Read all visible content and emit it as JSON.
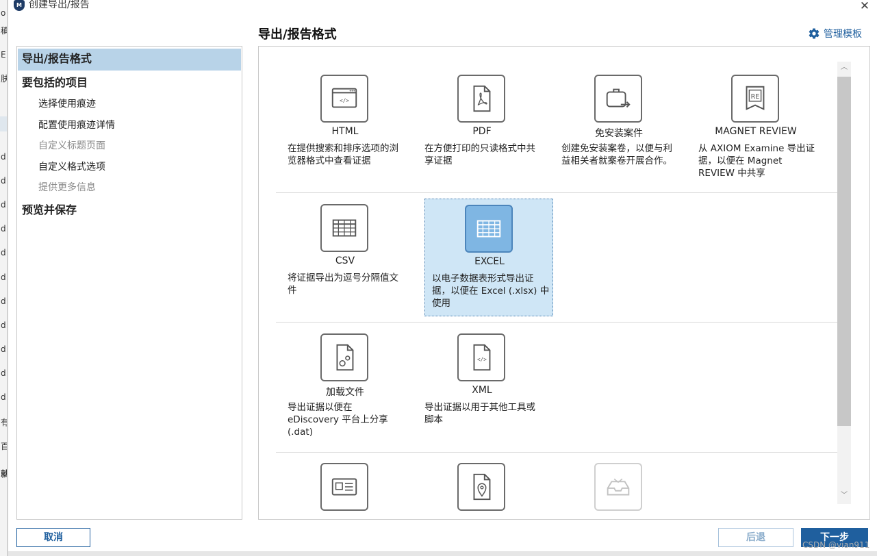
{
  "window": {
    "title": "创建导出/报告",
    "close_glyph": "✕"
  },
  "header": {
    "title": "导出/报告格式",
    "manage_templates": "管理模板"
  },
  "nav": {
    "items": [
      {
        "label": "导出/报告格式",
        "kind": "section",
        "active": true
      },
      {
        "label": "要包括的项目",
        "kind": "section"
      },
      {
        "label": "选择使用痕迹",
        "kind": "sub"
      },
      {
        "label": "配置使用痕迹详情",
        "kind": "sub"
      },
      {
        "label": "自定义标题页面",
        "kind": "sub",
        "disabled": true
      },
      {
        "label": "自定义格式选项",
        "kind": "sub"
      },
      {
        "label": "提供更多信息",
        "kind": "sub",
        "disabled": true
      },
      {
        "label": "预览并保存",
        "kind": "section"
      }
    ]
  },
  "formats": [
    {
      "name": "HTML",
      "desc": "在提供搜索和排序选项的浏览器格式中查看证据",
      "icon": "html-browser-icon"
    },
    {
      "name": "PDF",
      "desc": "在方便打印的只读格式中共享证据",
      "icon": "pdf-file-icon"
    },
    {
      "name": "免安装案件",
      "desc": "创建免安装案卷，以便与利益相关者就案卷开展合作。",
      "icon": "portable-case-icon"
    },
    {
      "name": "MAGNET REVIEW",
      "desc": "从 AXIOM Examine 导出证据，以便在 Magnet REVIEW 中共享",
      "icon": "magnet-review-icon"
    },
    {
      "name": "CSV",
      "desc": "将证据导出为逗号分隔值文件",
      "icon": "csv-table-icon"
    },
    {
      "name": "EXCEL",
      "desc": "以电子数据表形式导出证据，以便在 Excel (.xlsx) 中使用",
      "icon": "excel-table-icon",
      "selected": true
    },
    {
      "name": "加载文件",
      "desc": "导出证据以便在 eDiscovery 平台上分享 (.dat)",
      "icon": "load-file-icon"
    },
    {
      "name": "XML",
      "desc": "导出证据以用于其他工具或脚本",
      "icon": "xml-file-icon"
    },
    {
      "name": "",
      "desc": "",
      "icon": "id-card-icon"
    },
    {
      "name": "",
      "desc": "",
      "icon": "location-file-icon"
    },
    {
      "name": "",
      "desc": "",
      "icon": "inbox-tray-icon",
      "dim": true
    }
  ],
  "footer": {
    "cancel": "取消",
    "back": "后退",
    "next": "下一步"
  },
  "watermark": "CSDN @vian911",
  "colors": {
    "accent": "#1f5f9e",
    "nav_active": "#b8d3e8",
    "selected_card": "#cfe6f6"
  }
}
